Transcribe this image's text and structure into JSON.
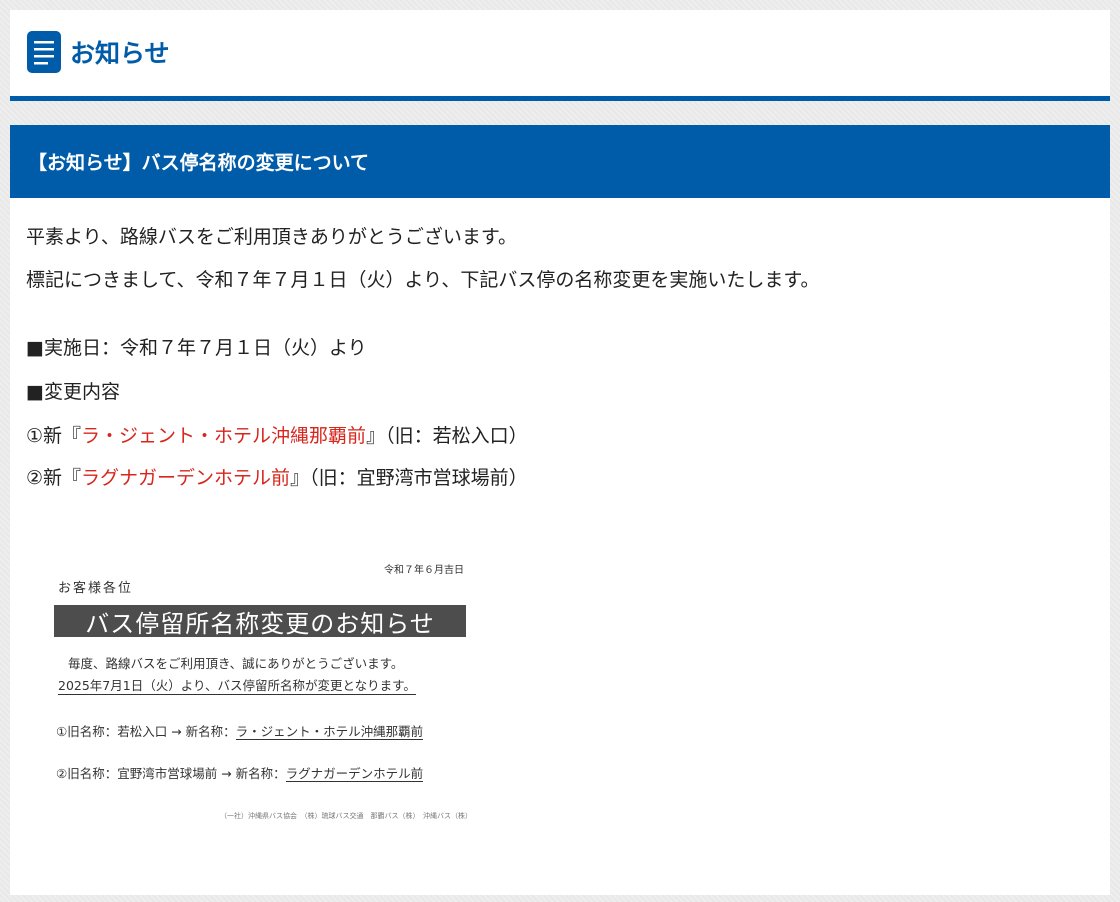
{
  "header": {
    "title": "お知らせ"
  },
  "article": {
    "title": "【お知らせ】バス停名称の変更について",
    "greeting": "平素より、路線バスをご利用頂きありがとうございます。",
    "intro": "標記につきまして、令和７年７月１日（火）より、下記バス停の名称変更を実施いたします。",
    "date_line": "■実施日：令和７年７月１日（火）より",
    "changes_heading": "■変更内容",
    "changes": [
      {
        "prefix": "①新『",
        "new_name": "ラ・ジェント・ホテル沖縄那覇前",
        "suffix": "』（旧：若松入口）"
      },
      {
        "prefix": "②新『",
        "new_name": "ラグナガーデンホテル前",
        "suffix": "』（旧：宜野湾市営球場前）"
      }
    ]
  },
  "notice_image": {
    "date": "令和７年６月吉日",
    "addressee": "お客様各位",
    "banner": "バス停留所名称変更のお知らせ",
    "line1": "毎度、路線バスをご利用頂き、誠にありがとうございます。",
    "line2": "2025年7月1日（火）より、バス停留所名称が変更となります。",
    "item1_old": "①旧名称：若松入口 → 新名称：",
    "item1_new": "ラ・ジェント・ホテル沖縄那覇前",
    "item2_old": "②旧名称：宜野湾市営球場前 → 新名称：",
    "item2_new": "ラグナガーデンホテル前",
    "footer": "（一社）沖縄県バス協会　（株）琉球バス交通　那覇バス（株）　沖縄バス（株）"
  },
  "colors": {
    "brand": "#005ba8",
    "highlight": "#d8261d"
  }
}
